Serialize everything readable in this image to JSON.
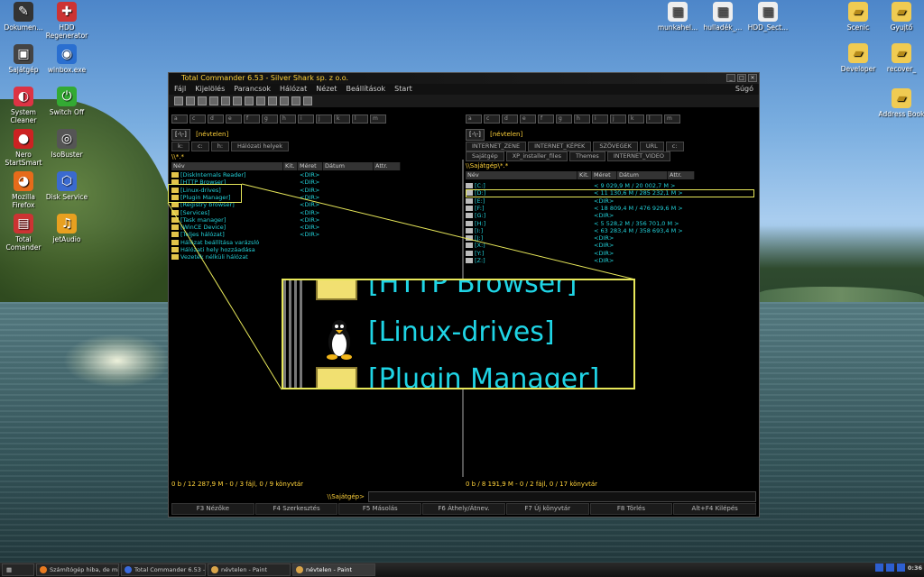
{
  "desktop": {
    "left_icons": [
      {
        "label": "Dokumen...",
        "glyph": "✎"
      },
      {
        "label": "HDD Regenerator",
        "glyph": "✚"
      },
      {
        "label": "Sajátgép",
        "glyph": "▣"
      },
      {
        "label": "winbox.exe",
        "glyph": "◉"
      },
      {
        "label": "System Cleaner",
        "glyph": "◐"
      },
      {
        "label": "Switch Off",
        "glyph": "⏻"
      },
      {
        "label": "Nero StartSmart",
        "glyph": "●"
      },
      {
        "label": "IsoBuster",
        "glyph": "◎"
      },
      {
        "label": "Mozilla Firefox",
        "glyph": "◕"
      },
      {
        "label": "Disk Service",
        "glyph": "⬡"
      },
      {
        "label": "Total Comander",
        "glyph": "▤"
      },
      {
        "label": "jetAudio",
        "glyph": "♫"
      }
    ],
    "right_icons": [
      {
        "label": "munkahel...",
        "glyph": "▦"
      },
      {
        "label": "hulladék_...",
        "glyph": "▦"
      },
      {
        "label": "HDD_Sect...",
        "glyph": "▦"
      },
      {
        "label": "Scenic",
        "glyph": "▰"
      },
      {
        "label": "Gyujtő",
        "glyph": "▰"
      },
      {
        "label": "Developer",
        "glyph": "▰"
      },
      {
        "label": "recover_",
        "glyph": "▰"
      },
      {
        "label": "Address Book",
        "glyph": "▰"
      }
    ]
  },
  "window": {
    "title": "Total Commander 6.53 - Silver Shark sp. z o.o.",
    "menu": [
      "Fájl",
      "Kijelölés",
      "Parancsok",
      "Hálózat",
      "Nézet",
      "Beállítások",
      "Start"
    ],
    "help": "Súgó",
    "drives": [
      "a",
      "c",
      "d",
      "e",
      "f",
      "g",
      "h",
      "i",
      "j",
      "k",
      "l",
      "m"
    ],
    "left": {
      "drive_select": "[-\\-]",
      "volume": "[névtelen]",
      "tabs": [
        "k:",
        "c:",
        "h:",
        "Hálózati helyek"
      ],
      "path": "\\\\*.*",
      "columns": [
        "Név",
        "Kit.",
        "Méret",
        "Dátum",
        "Attr."
      ],
      "rows": [
        {
          "name": "[DiskInternals Reader]",
          "size": "<DIR>"
        },
        {
          "name": "[HTTP Browser]",
          "size": "<DIR>"
        },
        {
          "name": "[Linux-drives]",
          "size": "<DIR>"
        },
        {
          "name": "[Plugin Manager]",
          "size": "<DIR>"
        },
        {
          "name": "[Registry browser]",
          "size": "<DIR>"
        },
        {
          "name": "[Services]",
          "size": "<DIR>"
        },
        {
          "name": "[Task manager]",
          "size": "<DIR>"
        },
        {
          "name": "[WinCE Device]",
          "size": "<DIR>"
        },
        {
          "name": "[Teljes hálózat]",
          "size": "<DIR>"
        },
        {
          "name": "Hálózat beállítása varázsló",
          "size": ""
        },
        {
          "name": "Hálózati hely hozzáadása",
          "size": ""
        },
        {
          "name": "Vezeték nélküli hálózat",
          "size": ""
        }
      ],
      "status": "0 b / 12 287,9 M - 0 / 3 fájl, 0 / 9 könyvtár"
    },
    "right": {
      "drive_select": "[-\\-]",
      "volume": "[névtelen]",
      "tabs_row1": [
        "INTERNET_ZENE",
        "INTERNET_KÉPEK",
        "SZÖVEGEK",
        "URL",
        "c:"
      ],
      "tabs_row2": [
        "Sajátgép",
        "XP_installer_files",
        "Themes",
        "INTERNET_VIDEO"
      ],
      "path": "\\\\Sajátgép\\*.*",
      "columns": [
        "Név",
        "Kit.",
        "Méret",
        "Dátum",
        "Attr."
      ],
      "rows": [
        {
          "name": "[C:]",
          "size": "< 9 029,9 M / 20 002,7 M >"
        },
        {
          "name": "[D:]",
          "size": "< 11 130,6 M / 285 232,1 M >"
        },
        {
          "name": "[E:]",
          "size": "<DIR>"
        },
        {
          "name": "[F:]",
          "size": "< 18 809,4 M / 476 929,6 M >"
        },
        {
          "name": "[G:]",
          "size": "<DIR>"
        },
        {
          "name": "[H:]",
          "size": "< 5 528,2 M / 356 701,0 M >"
        },
        {
          "name": "[I:]",
          "size": "< 63 283,4 M / 358 693,4 M >"
        },
        {
          "name": "[J:]",
          "size": "<DIR>"
        },
        {
          "name": "[X:]",
          "size": "<DIR>"
        },
        {
          "name": "[Y:]",
          "size": "<DIR>"
        },
        {
          "name": "[Z:]",
          "size": "<DIR>"
        }
      ],
      "status": "0 b / 8 191,9 M - 0 / 2 fájl, 0 / 17 könyvtár"
    },
    "cmd_prompt": "\\\\Sajátgép>",
    "fkeys": [
      "F3 Nézőke",
      "F4 Szerkesztés",
      "F5 Másolás",
      "F6 Áthely/Átnev.",
      "F7 Új könyvtár",
      "F8 Törlés",
      "Alt+F4 Kilépés"
    ]
  },
  "zoom": {
    "rows": [
      "[HTTP Browser]",
      "[Linux-drives]",
      "[Plugin Manager]"
    ]
  },
  "taskbar": {
    "items": [
      "Számítógép hiba, de mi a pr...",
      "Total Commander 6.53 - Sil...",
      "névtelen - Paint",
      "névtelen - Paint"
    ],
    "clock": "0:36"
  },
  "colors": {
    "accent": "#ffd23a",
    "file_text": "#22d0d8",
    "highlight": "#e8e85a"
  }
}
